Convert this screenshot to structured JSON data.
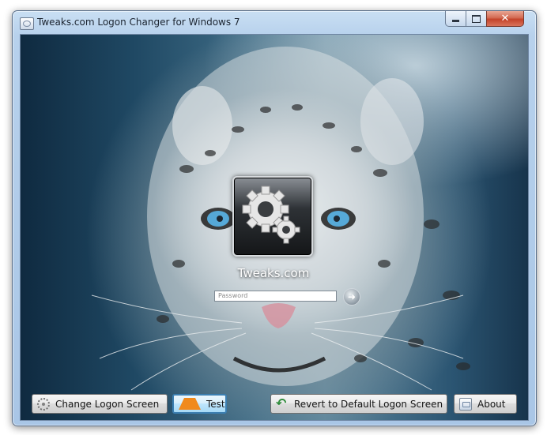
{
  "window": {
    "title": "Tweaks.com Logon Changer for Windows 7",
    "close_glyph": "✕"
  },
  "logon_preview": {
    "user_name": "Tweaks.com",
    "password_placeholder": "Password",
    "submit_glyph": "➜"
  },
  "buttons": {
    "change_label": "Change Logon Screen",
    "test_label": "Test",
    "revert_label": "Revert to Default Logon Screen",
    "about_label": "About"
  },
  "icons": {
    "app": "app-icon",
    "change": "gear-icon",
    "test": "traffic-cone-icon",
    "revert": "undo-arrow-icon",
    "about": "window-info-icon",
    "user_tile": "gears-icon"
  },
  "colors": {
    "titlebar": "#b7d1ec",
    "close_button": "#c4432a",
    "focused_button_border": "#3c7fb1",
    "background_deep_blue": "#1f4863"
  }
}
